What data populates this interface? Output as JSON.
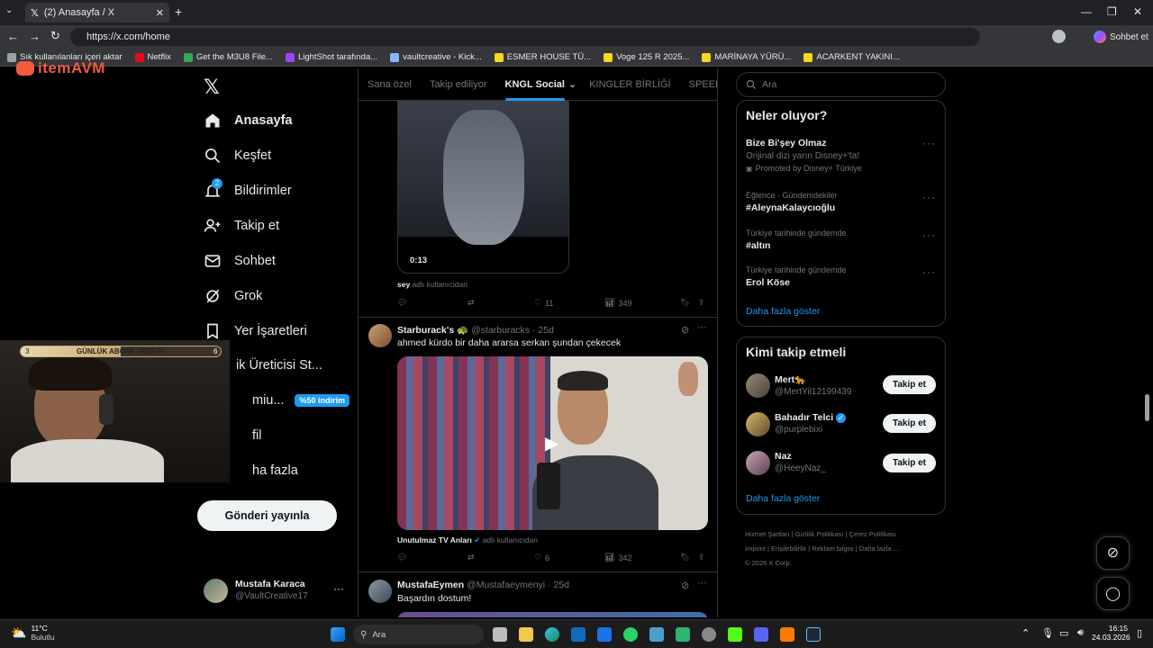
{
  "browser": {
    "tab_title": "(2) Anasayfa / X",
    "url": "https://x.com/home",
    "copilot_label": "Sohbet et",
    "bookmarks": [
      {
        "label": "Sık kullanılanları içeri aktar",
        "color": "#9aa0a6"
      },
      {
        "label": "Netflix",
        "color": "#e50914"
      },
      {
        "label": "Get the M3U8 File...",
        "color": "#34a853"
      },
      {
        "label": "LightShot tarafında...",
        "color": "#a142f4"
      },
      {
        "label": "vaultcreative - Kick...",
        "color": "#8ab4f8"
      },
      {
        "label": "ESMER HOUSE TÜ...",
        "color": "#f9d71c"
      },
      {
        "label": "Voge 125 R 2025...",
        "color": "#f9d71c"
      },
      {
        "label": "MARİNAYA YÜRÜ...",
        "color": "#f9d71c"
      },
      {
        "label": "ACARKENT YAKINI...",
        "color": "#f9d71c"
      }
    ]
  },
  "overlay": {
    "brand": "itemAVM",
    "goal_label": "GÜNLÜK ABONE HEDEFİ",
    "goal_current": "3",
    "goal_target": "6"
  },
  "nav": {
    "home": "Anasayfa",
    "explore": "Keşfet",
    "notifications": "Bildirimler",
    "notifications_badge": "2",
    "follow": "Takip et",
    "chat": "Sohbet",
    "grok": "Grok",
    "bookmarks": "Yer İşaretleri",
    "creator": "ik Üreticisi St...",
    "premium": "miu...",
    "premium_badge": "%50 indirim",
    "profile": "fil",
    "more": "ha fazla",
    "post_button": "Gönderi yayınla",
    "account_name": "Mustafa Karaca",
    "account_handle": "@VaultCreative17"
  },
  "feed": {
    "tabs": [
      "Sana özel",
      "Takip ediliyor",
      "KNGL Social",
      "KINGLER BİRLİĞİ",
      "SPEED G"
    ],
    "active_tab": 2,
    "tweet1": {
      "duration": "0:13",
      "source_user": "sey",
      "source_suffix": "adlı kullanıcıdan",
      "likes": "11",
      "views": "349"
    },
    "tweet2": {
      "name": "Starburack's",
      "emoji": "🐢",
      "handle": "@starburacks",
      "time": "· 25d",
      "text": "ahmed kürdo bir daha ararsa serkan şundan çekecek",
      "source_user": "Unutulmaz TV Anları",
      "source_suffix": "adlı kullanıcıdan",
      "likes": "6",
      "views": "342"
    },
    "tweet3": {
      "name": "MustafaEymen",
      "handle": "@Mustafaeymenyi",
      "time": "· 25d",
      "text": "Başardın dostum!"
    }
  },
  "sidebar": {
    "search_placeholder": "Ara",
    "trends_title": "Neler oluyor?",
    "trends": [
      {
        "meta": "",
        "title": "Bize Bi'şey Olmaz",
        "sub": "Orijinal dizi yarın Disney+'ta!",
        "promo": "Promoted by Disney+ Türkiye"
      },
      {
        "meta": "Eğlence · Gündemdekiler",
        "title": "#AleynaKalaycıoğlu"
      },
      {
        "meta": "Türkiye tarihinde gündemde",
        "title": "#altın"
      },
      {
        "meta": "Türkiye tarihinde gündemde",
        "title": "Erol Köse"
      }
    ],
    "show_more": "Daha fazla göster",
    "who_title": "Kimi takip etmeli",
    "who": [
      {
        "name": "Mert🐆",
        "handle": "@MertYil12199439",
        "verified": false
      },
      {
        "name": "Bahadır Telci",
        "handle": "@purplebixi",
        "verified": true
      },
      {
        "name": "Naz",
        "handle": "@HeeyNaz_",
        "verified": false
      }
    ],
    "follow_label": "Takip et",
    "who_more": "Daha fazla göster",
    "footer_row1": [
      "Hizmet Şartları",
      "Gizlilik Politikası",
      "Çerez Politikası"
    ],
    "footer_row2": [
      "Imprint",
      "Erişilebilirlik",
      "Reklam bilgisi",
      "Daha fazla ..."
    ],
    "copyright": "© 2026 X Corp."
  },
  "taskbar": {
    "temp": "11°C",
    "weather": "Bulutlu",
    "search": "Ara",
    "time": "16:15",
    "date": "24.03.2026"
  }
}
